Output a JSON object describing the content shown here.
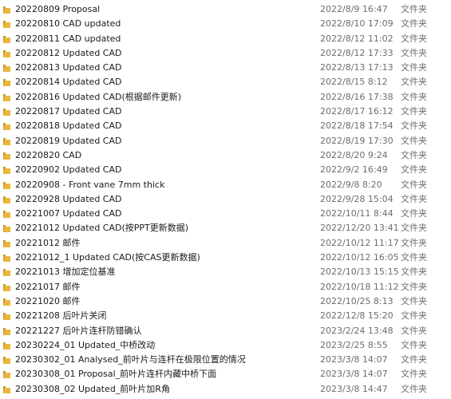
{
  "folder_color": "#e8b83c",
  "rows": [
    {
      "name": "20220809 Proposal",
      "date": "2022/8/9 16:47",
      "type": "文件夹"
    },
    {
      "name": "20220810 CAD updated",
      "date": "2022/8/10 17:09",
      "type": "文件夹"
    },
    {
      "name": "20220811 CAD updated",
      "date": "2022/8/12 11:02",
      "type": "文件夹"
    },
    {
      "name": "20220812 Updated CAD",
      "date": "2022/8/12 17:33",
      "type": "文件夹"
    },
    {
      "name": "20220813 Updated CAD",
      "date": "2022/8/13 17:13",
      "type": "文件夹"
    },
    {
      "name": "20220814 Updated CAD",
      "date": "2022/8/15 8:12",
      "type": "文件夹"
    },
    {
      "name": "20220816 Updated CAD(根据邮件更新)",
      "date": "2022/8/16 17:38",
      "type": "文件夹"
    },
    {
      "name": "20220817 Updated CAD",
      "date": "2022/8/17 16:12",
      "type": "文件夹"
    },
    {
      "name": "20220818 Updated CAD",
      "date": "2022/8/18 17:54",
      "type": "文件夹"
    },
    {
      "name": "20220819 Updated CAD",
      "date": "2022/8/19 17:30",
      "type": "文件夹"
    },
    {
      "name": "20220820 CAD",
      "date": "2022/8/20 9:24",
      "type": "文件夹"
    },
    {
      "name": "20220902 Updated CAD",
      "date": "2022/9/2 16:49",
      "type": "文件夹"
    },
    {
      "name": "20220908 - Front vane 7mm thick",
      "date": "2022/9/8 8:20",
      "type": "文件夹"
    },
    {
      "name": "20220928 Updated CAD",
      "date": "2022/9/28 15:04",
      "type": "文件夹"
    },
    {
      "name": "20221007 Updated CAD",
      "date": "2022/10/11 8:44",
      "type": "文件夹"
    },
    {
      "name": "20221012 Updated CAD(按PPT更新数据)",
      "date": "2022/12/20 13:41",
      "type": "文件夹"
    },
    {
      "name": "20221012 邮件",
      "date": "2022/10/12 11:17",
      "type": "文件夹"
    },
    {
      "name": "20221012_1 Updated CAD(按CAS更新数据)",
      "date": "2022/10/12 16:05",
      "type": "文件夹"
    },
    {
      "name": "20221013 增加定位基准",
      "date": "2022/10/13 15:15",
      "type": "文件夹"
    },
    {
      "name": "20221017 邮件",
      "date": "2022/10/18 11:12",
      "type": "文件夹"
    },
    {
      "name": "20221020 邮件",
      "date": "2022/10/25 8:13",
      "type": "文件夹"
    },
    {
      "name": "20221208 后叶片关闭",
      "date": "2022/12/8 15:20",
      "type": "文件夹"
    },
    {
      "name": "20221227 后叶片连杆防错确认",
      "date": "2023/2/24 13:48",
      "type": "文件夹"
    },
    {
      "name": "20230224_01 Updated_中桥改动",
      "date": "2023/2/25 8:55",
      "type": "文件夹"
    },
    {
      "name": "20230302_01 Analysed_前叶片与连杆在极限位置的情况",
      "date": "2023/3/8 14:07",
      "type": "文件夹"
    },
    {
      "name": "20230308_01 Proposal_前叶片连杆内藏中桥下面",
      "date": "2023/3/8 14:07",
      "type": "文件夹"
    },
    {
      "name": "20230308_02 Updated_前叶片加R角",
      "date": "2023/3/8 14:47",
      "type": "文件夹"
    }
  ]
}
